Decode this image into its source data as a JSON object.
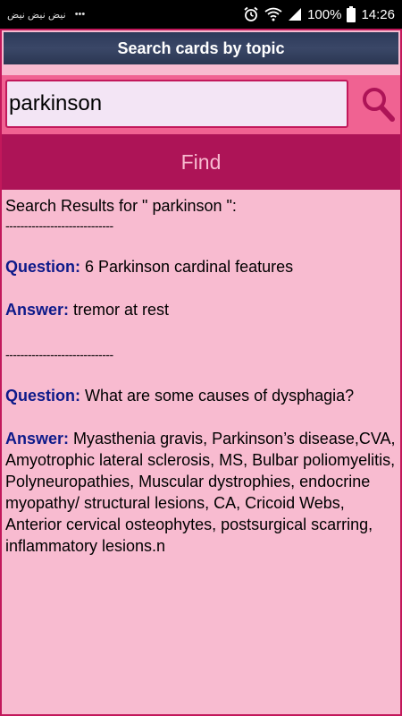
{
  "status_bar": {
    "left_text": "نيض نيض نيض",
    "dots": "•••",
    "battery": "100%",
    "time": "14:26"
  },
  "header": {
    "title": "Search cards by topic"
  },
  "search": {
    "value": "parkinson"
  },
  "find_button": {
    "label": "Find"
  },
  "results": {
    "heading": "Search Results for \" parkinson \":",
    "divider": "-----------------------------",
    "items": [
      {
        "question_label": "Question:",
        "question": " 6 Parkinson cardinal features",
        "answer_label": "Answer:",
        "answer": " tremor at rest"
      },
      {
        "question_label": "Question:",
        "question": " What are some causes of dysphagia?",
        "answer_label": "Answer:",
        "answer": " Myasthenia gravis, Parkinson’s disease,CVA, Amyotrophic lateral sclerosis, MS, Bulbar poliomyelitis, Polyneuropathies, Muscular dystrophies, endocrine myopathy/ structural lesions, CA, Cricoid Webs, Anterior cervical osteophytes, postsurgical scarring, inflammatory lesions.n"
      }
    ]
  },
  "colors": {
    "background": "#f8bbd0",
    "accent": "#ad1457",
    "search_bar": "#f06292",
    "label": "#0d1a8a"
  }
}
